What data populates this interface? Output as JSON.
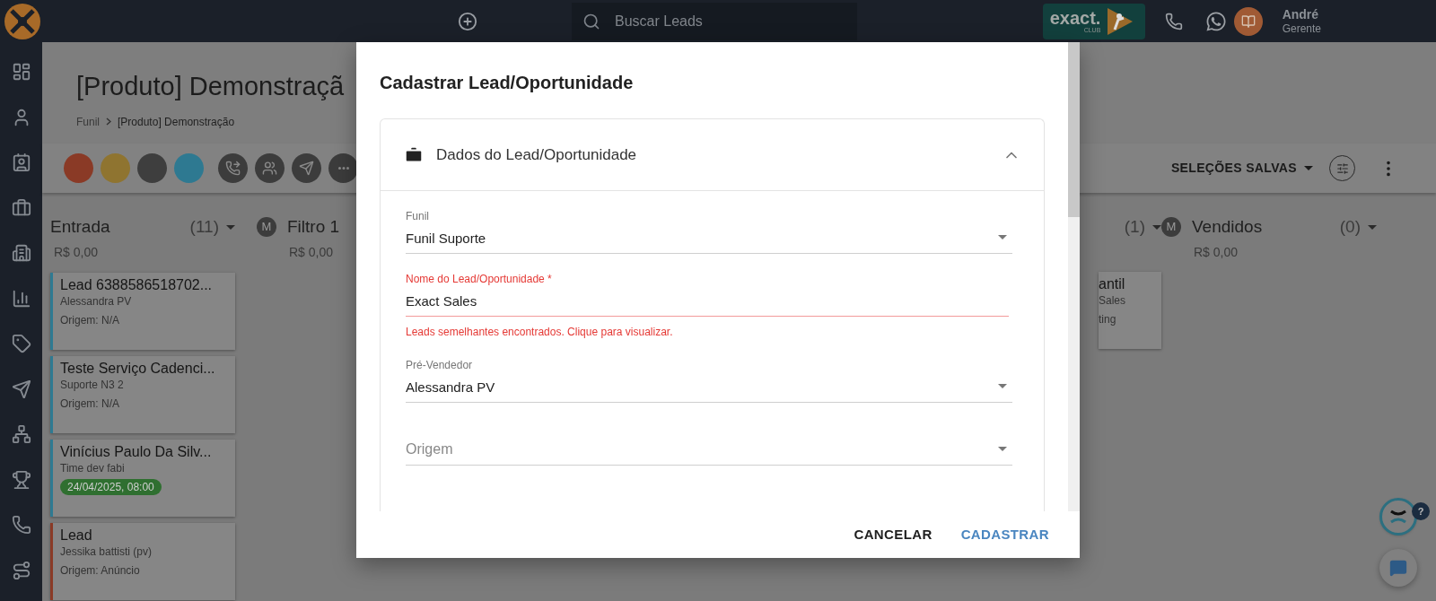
{
  "top_bar": {
    "search": {
      "placeholder": "Buscar Leads"
    },
    "brand": {
      "name": "exact.",
      "sub": "CLUB"
    },
    "user": {
      "name": "André",
      "role": "Gerente"
    }
  },
  "page": {
    "title": "[Produto] Demonstraçã",
    "breadcrumb": [
      "Funil",
      "[Produto] Demonstração"
    ]
  },
  "toolbar": {
    "color_filters": [
      {
        "color": "#8a3a26"
      },
      {
        "color": "#8f7430"
      },
      {
        "color": "#3e3e3e"
      },
      {
        "color": "#2e7991"
      }
    ],
    "saved_selections": "SELEÇÕES SALVAS"
  },
  "columns": [
    {
      "kind": "full",
      "title": "Entrada",
      "count": "(11)",
      "total": "R$ 0,00",
      "cards": [
        {
          "title": "Lead 6388586518702...",
          "subtitle": "Alessandra PV",
          "origin": "Origem: N/A",
          "color": "#2f7a92"
        },
        {
          "title": "Teste Serviço Cadenci...",
          "subtitle": "Suporte N3 2",
          "origin": "Origem: N/A",
          "color": "#2f7a92"
        },
        {
          "title": "Vinícius Paulo Da Silv...",
          "subtitle": "Time dev fabi",
          "date": "24/04/2025, 08:00",
          "color": "#2f7a92"
        },
        {
          "title": "Lead",
          "subtitle": "Jessika battisti (pv)",
          "origin": "Origem: Anúncio",
          "color": "#8a3a26"
        }
      ]
    },
    {
      "kind": "head",
      "badge": "M",
      "title": "Filtro 1",
      "total": "R$ 0,00"
    },
    {
      "kind": "tail",
      "count": "(1)",
      "cards": [
        {
          "title": "antil",
          "subtitle": "Sales",
          "origin": "ting"
        }
      ]
    },
    {
      "kind": "full",
      "badge": "M",
      "title": "Vendidos",
      "count": "(0)",
      "total": "R$ 0,00"
    }
  ],
  "dialog": {
    "title": "Cadastrar Lead/Oportunidade",
    "section": {
      "title": "Dados do Lead/Oportunidade",
      "expanded": true
    },
    "fields": [
      {
        "kind": "select",
        "label": "Funil",
        "value": "Funil Suporte",
        "invalid": false
      },
      {
        "kind": "text",
        "label": "Nome do Lead/Oportunidade *",
        "value": "Exact Sales",
        "invalid": true,
        "error": "Leads semelhantes encontrados. Clique para visualizar."
      },
      {
        "kind": "select",
        "label": "Pré-Vendedor",
        "value": "Alessandra PV",
        "invalid": false
      },
      {
        "kind": "select",
        "placeholder": "Origem",
        "invalid": false
      }
    ],
    "buttons": [
      {
        "label": "CANCELAR",
        "primary": false
      },
      {
        "label": "CADASTRAR",
        "primary": true
      }
    ]
  },
  "help_badge": "?"
}
